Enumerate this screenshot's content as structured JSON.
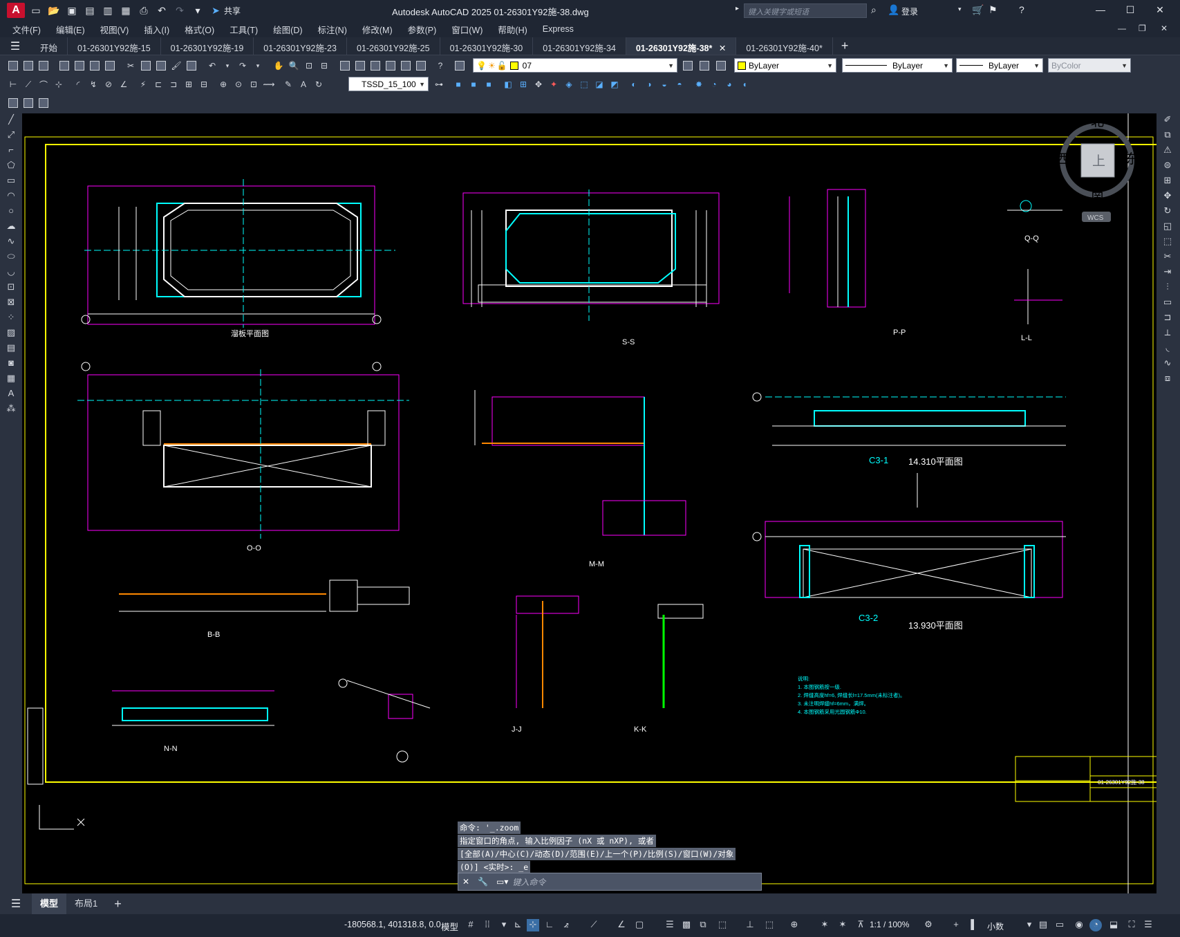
{
  "app": {
    "title": "Autodesk AutoCAD 2025    01-26301Y92施-38.dwg",
    "logo": "A",
    "share_label": "共享",
    "search_placeholder": "键入关键字或短语",
    "login_label": "登录"
  },
  "menu": [
    "文件(F)",
    "编辑(E)",
    "视图(V)",
    "插入(I)",
    "格式(O)",
    "工具(T)",
    "绘图(D)",
    "标注(N)",
    "修改(M)",
    "参数(P)",
    "窗口(W)",
    "帮助(H)",
    "Express"
  ],
  "doc_tabs": [
    {
      "label": "开始"
    },
    {
      "label": "01-26301Y92施-15"
    },
    {
      "label": "01-26301Y92施-19"
    },
    {
      "label": "01-26301Y92施-23"
    },
    {
      "label": "01-26301Y92施-25"
    },
    {
      "label": "01-26301Y92施-30"
    },
    {
      "label": "01-26301Y92施-34"
    },
    {
      "label": "01-26301Y92施-38*",
      "active": true
    },
    {
      "label": "01-26301Y92施-40*"
    }
  ],
  "toolbar": {
    "layer_value": "07",
    "color_value": "ByLayer",
    "linetype_value": "ByLayer",
    "lineweight_value": "ByLayer",
    "plotstyle_value": "ByColor",
    "dimstyle_value": "TSSD_15_100"
  },
  "viewcube": {
    "north": "北",
    "south": "南",
    "east": "东",
    "west": "西",
    "face": "上",
    "wcs": "WCS"
  },
  "drawing": {
    "labels": [
      "溜板平面图",
      "S-S",
      "P-P",
      "Q-Q",
      "L-L",
      "O-O",
      "M-M",
      "B-B",
      "N-N",
      "J-J",
      "K-K",
      "C3-1",
      "14.310平面图",
      "C3-2",
      "13.930平面图"
    ],
    "notes_title": "说明:",
    "notes": [
      "1. 本图钢筋按一级.",
      "2. 焊缝高度hf=6, 焊缝长l=17.5mm(未标注者)。",
      "3. 未注明焊缝hf=6mm，满焊。",
      "4. 本图钢筋采用光圆钢筋Φ10.",
      "5."
    ],
    "titleblock_no": "01-26301Y92施-38"
  },
  "command": {
    "history": [
      "命令: '_.zoom",
      "指定窗口的角点, 输入比例因子 (nX 或 nXP), 或者",
      "[全部(A)/中心(C)/动态(D)/范围(E)/上一个(P)/比例(S)/窗口(W)/对象",
      "(O)] <实时>: _e"
    ],
    "placeholder": "键入命令"
  },
  "layout_tabs": [
    {
      "label": "模型",
      "active": true
    },
    {
      "label": "布局1"
    }
  ],
  "status": {
    "coords": "-180568.1, 401318.8, 0.0",
    "model_label": "模型",
    "scale": "1:1 / 100%",
    "units": "小数"
  }
}
